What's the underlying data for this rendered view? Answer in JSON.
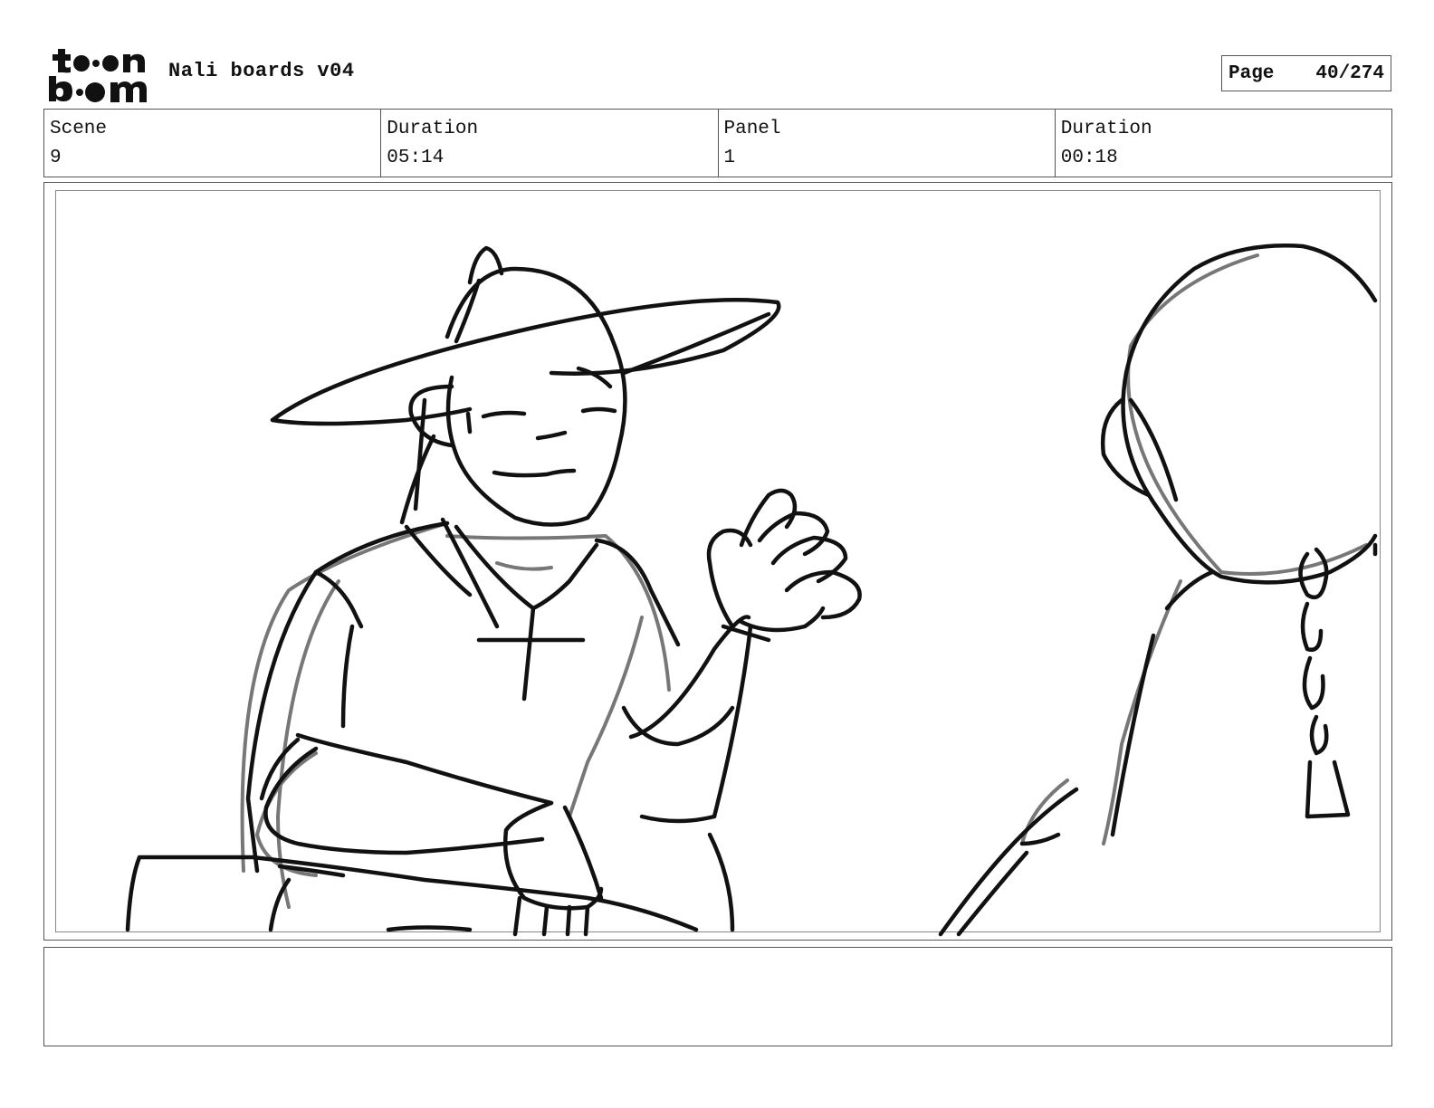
{
  "header": {
    "logo_text": "toon boom",
    "title": "Nali boards v04",
    "page_label": "Page",
    "page_value": "40/274"
  },
  "info": {
    "scene_label": "Scene",
    "scene_value": "9",
    "scene_duration_label": "Duration",
    "scene_duration_value": "05:14",
    "panel_label": "Panel",
    "panel_value": "1",
    "panel_duration_label": "Duration",
    "panel_duration_value": "00:18"
  },
  "notes": {
    "text": ""
  }
}
